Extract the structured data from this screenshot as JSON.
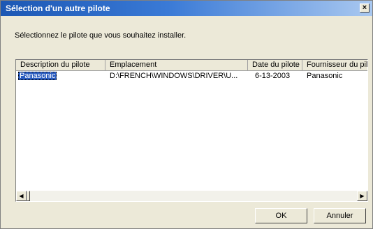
{
  "window": {
    "title": "Sélection d'un autre pilote",
    "close_glyph": "×"
  },
  "instruction": "Sélectionnez le pilote que vous souhaitez installer.",
  "columns": [
    "Description du pilote",
    "Emplacement",
    "Date du pilote",
    "Fournisseur du pil"
  ],
  "rows": [
    [
      "Panasonic",
      "D:\\FRENCH\\WINDOWS\\DRIVER\\U...",
      "6-13-2003",
      "Panasonic"
    ]
  ],
  "scrollbar": {
    "left_arrow": "◀",
    "right_arrow": "▶"
  },
  "buttons": {
    "ok": "OK",
    "cancel": "Annuler"
  },
  "colors": {
    "title_bar": "#1c57b4",
    "dialog_bg": "#ece9d8",
    "selection": "#2a5cc0"
  }
}
